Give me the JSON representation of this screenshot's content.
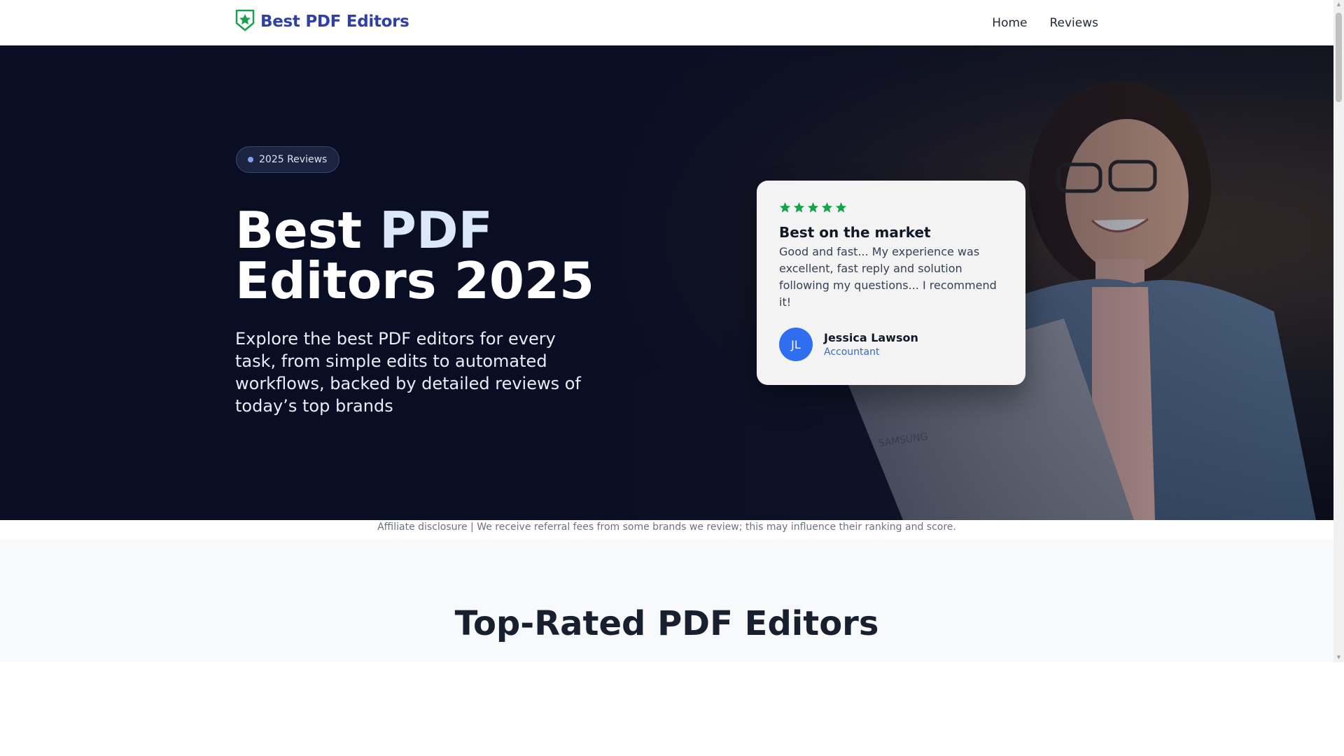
{
  "header": {
    "logo_text": "Best PDF Editors",
    "nav": [
      {
        "label": "Home"
      },
      {
        "label": "Reviews"
      }
    ]
  },
  "hero": {
    "badge": "2025 Reviews",
    "title_part1": "Best ",
    "title_accent": "PDF",
    "title_part2": "Editors 2025",
    "subtitle": "Explore the best PDF editors for every task, from simple edits to automated workflows, backed by detailed reviews of today’s top brands",
    "review": {
      "rating": 5,
      "title": "Best on the market",
      "text": "Good and fast... My experience was excellent, fast reply and solution following my questions... I recommend it!",
      "avatar_initials": "JL",
      "name": "Jessica Lawson",
      "role": "Accountant"
    }
  },
  "disclosure": "Affiliate disclosure | We receive referral fees from some brands we review; this may influence their ranking and score.",
  "section": {
    "title": "Top-Rated PDF Editors"
  },
  "colors": {
    "brand": "#2f3fa8",
    "star": "#16a34a",
    "avatar": "#2f6ef0"
  },
  "icons": {
    "logo": "shield-star-icon",
    "star": "star-icon"
  }
}
